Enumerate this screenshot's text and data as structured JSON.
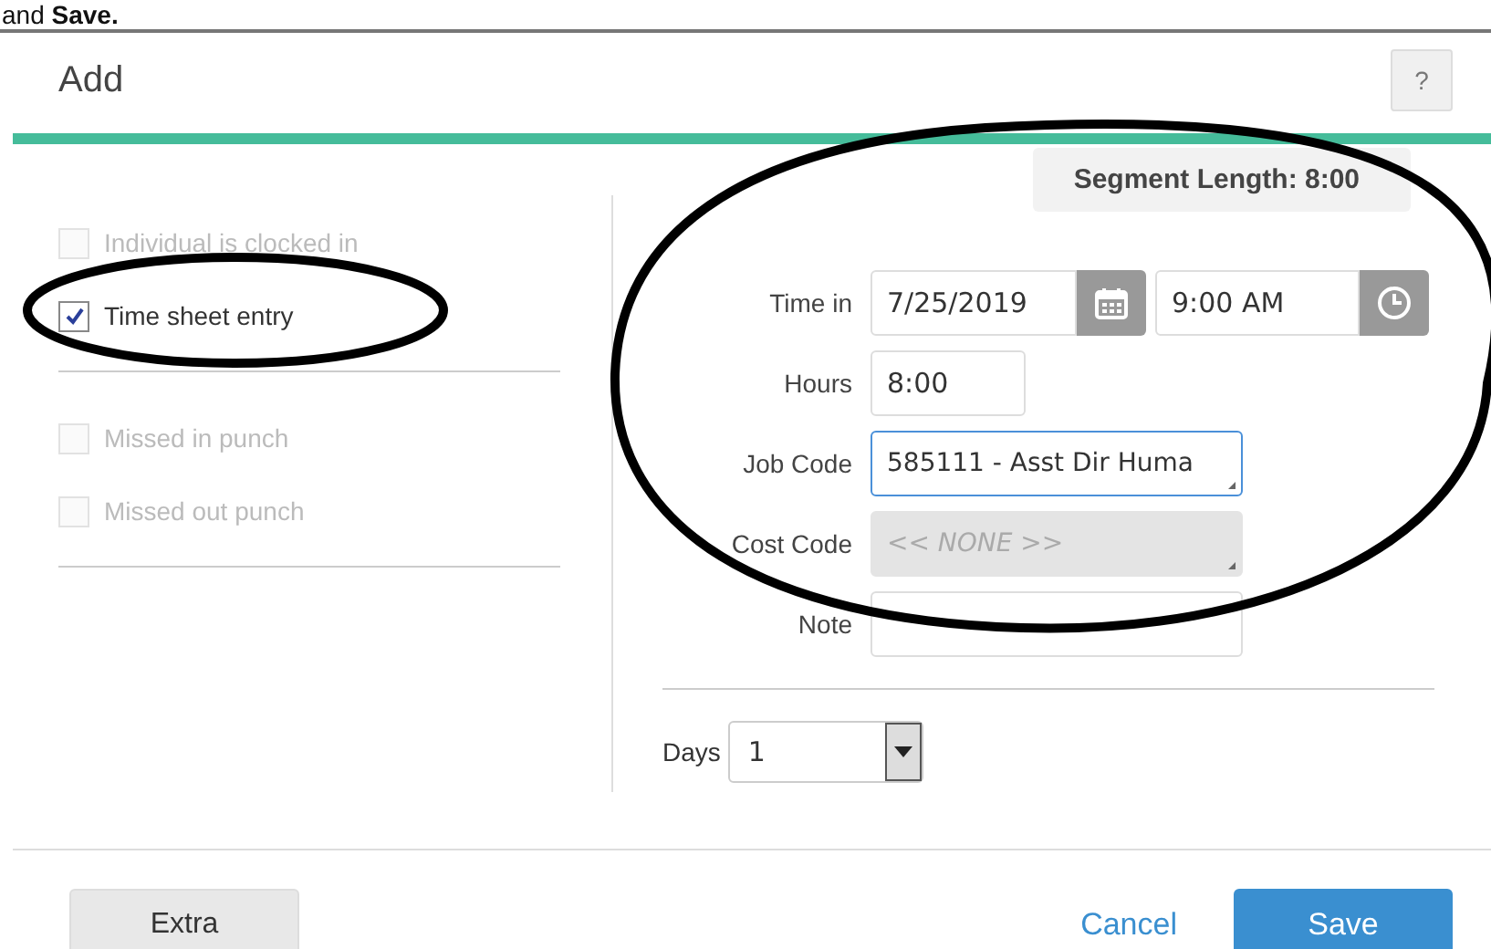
{
  "caption": {
    "text": "and **Save.**"
  },
  "dialog": {
    "title": "Add",
    "help_button": "?"
  },
  "options": [
    {
      "label": "Individual is clocked in",
      "checked": false,
      "disabled": true
    },
    {
      "label": "Time sheet entry",
      "checked": true,
      "disabled": false
    }
  ],
  "punch_options": [
    {
      "label": "Missed in punch",
      "checked": false,
      "disabled": true
    },
    {
      "label": "Missed out punch",
      "checked": false,
      "disabled": true
    }
  ],
  "segment_length": "Segment Length: 8:00",
  "fields": [
    {
      "kind": "datetime",
      "label": "Time in",
      "date": "7/25/2019",
      "time": "9:00 AM"
    },
    {
      "kind": "short",
      "label": "Hours",
      "value": "8:00"
    },
    {
      "kind": "combo",
      "label": "Job Code",
      "value": "585111 - Asst Dir Huma",
      "focused": true,
      "disabled": false
    },
    {
      "kind": "combo",
      "label": "Cost Code",
      "value": "<< NONE >>",
      "focused": false,
      "disabled": true
    },
    {
      "kind": "text",
      "label": "Note"
    }
  ],
  "days": {
    "label": "Days",
    "value": "1"
  },
  "buttons": {
    "extra": "Extra",
    "cancel": "Cancel",
    "save": "Save"
  }
}
